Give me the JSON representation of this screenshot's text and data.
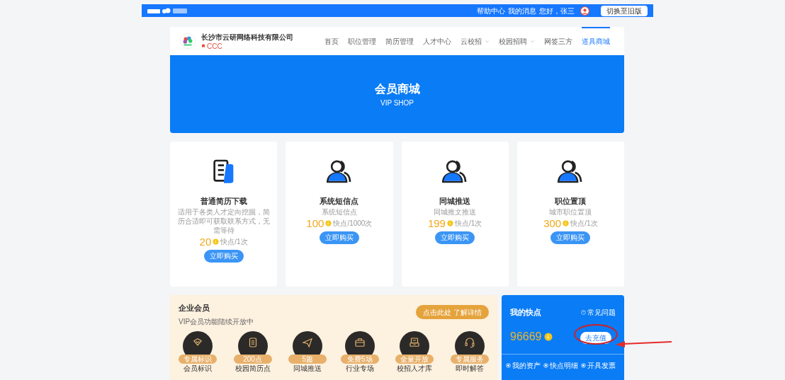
{
  "top_bar": {
    "links": [
      "帮助中心",
      "我的消息"
    ],
    "greeting": "您好，张三",
    "switch_button": "切换至旧版"
  },
  "header": {
    "company": "长沙市云研网络科技有限公司",
    "tag": "CCC",
    "nav": [
      {
        "label": "首页",
        "selected": false,
        "dropdown": false
      },
      {
        "label": "职位管理",
        "selected": false,
        "dropdown": false
      },
      {
        "label": "简历管理",
        "selected": false,
        "dropdown": false
      },
      {
        "label": "人才中心",
        "selected": false,
        "dropdown": false
      },
      {
        "label": "云校招",
        "selected": false,
        "dropdown": true
      },
      {
        "label": "校园招聘",
        "selected": false,
        "dropdown": true
      },
      {
        "label": "网签三方",
        "selected": false,
        "dropdown": false
      },
      {
        "label": "道具商城",
        "selected": true,
        "dropdown": false
      }
    ]
  },
  "banner": {
    "title": "会员商城",
    "subtitle": "VIP SHOP"
  },
  "products": [
    {
      "kind": "document",
      "title": "普通简历下载",
      "description": "适用于各类人才定向挖掘，简历合适即可获取联系方式，无需等待",
      "price": "20",
      "unit": "快点/1次",
      "button": "立即购买"
    },
    {
      "kind": "people",
      "title": "系统短信点",
      "description": "系统短信点",
      "price": "100",
      "unit": "快点/1000次",
      "button": "立即购买"
    },
    {
      "kind": "people",
      "title": "同城推送",
      "description": "同城推文推送",
      "price": "199",
      "unit": "快点/1次",
      "button": "立即购买"
    },
    {
      "kind": "people",
      "title": "职位置顶",
      "description": "城市职位置顶",
      "price": "300",
      "unit": "快点/1次",
      "button": "立即购买"
    }
  ],
  "membership": {
    "title": "企业会员",
    "subtitle": "VIP会员功能陆续开放中",
    "button": "点击此处 了解详情",
    "perks": [
      {
        "kind": "diamond",
        "badge": "专属标识",
        "label": "会员标识"
      },
      {
        "kind": "document",
        "badge": "200点",
        "label": "校园简历点"
      },
      {
        "kind": "plane",
        "badge": "5篇",
        "label": "同城推送"
      },
      {
        "kind": "briefcase",
        "badge": "免费5场",
        "label": "行业专场"
      },
      {
        "kind": "cabinet",
        "badge": "全量开放",
        "label": "校招人才库"
      },
      {
        "kind": "headset",
        "badge": "专属服务",
        "label": "即时解答"
      }
    ]
  },
  "points": {
    "title": "我的快点",
    "help": "常见问题",
    "balance": "96669",
    "recharge": "去充值",
    "links": [
      "我的资产",
      "快点明细",
      "开具发票"
    ]
  }
}
